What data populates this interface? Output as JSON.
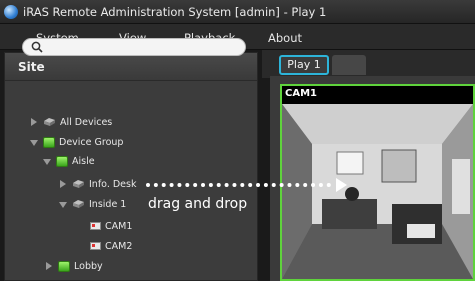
{
  "window": {
    "title": "iRAS Remote Administration System [admin] - Play 1"
  },
  "menu": {
    "items": [
      "System",
      "View",
      "Playback",
      "About"
    ]
  },
  "sidebar": {
    "header": "Site",
    "search": {
      "value": "",
      "placeholder": ""
    },
    "tree": [
      {
        "label": "All Devices",
        "level": 0,
        "expander": "closed",
        "icon": "server-group-icon"
      },
      {
        "label": "Device Group",
        "level": 0,
        "expander": "open",
        "icon": "group-folder-icon"
      },
      {
        "label": "Aisle",
        "level": 1,
        "expander": "open",
        "icon": "group-folder-icon"
      },
      {
        "label": "Info. Desk",
        "level": 2,
        "expander": "closed",
        "icon": "device-icon"
      },
      {
        "label": "Inside 1",
        "level": 2,
        "expander": "open",
        "icon": "device-icon"
      },
      {
        "label": "CAM1",
        "level": 3,
        "expander": "none",
        "icon": "camera-icon"
      },
      {
        "label": "CAM2",
        "level": 3,
        "expander": "none",
        "icon": "camera-icon"
      },
      {
        "label": "Lobby",
        "level": 1,
        "expander": "closed",
        "icon": "group-folder-icon"
      }
    ]
  },
  "annotation": {
    "text": "drag and drop"
  },
  "tabs": [
    {
      "label": "Play 1",
      "active": true
    }
  ],
  "video": {
    "channel_label": "CAM1"
  },
  "colors": {
    "tab_border": "#2db4d9",
    "video_border": "#5fd33c",
    "group_icon": "#5fd33c"
  }
}
